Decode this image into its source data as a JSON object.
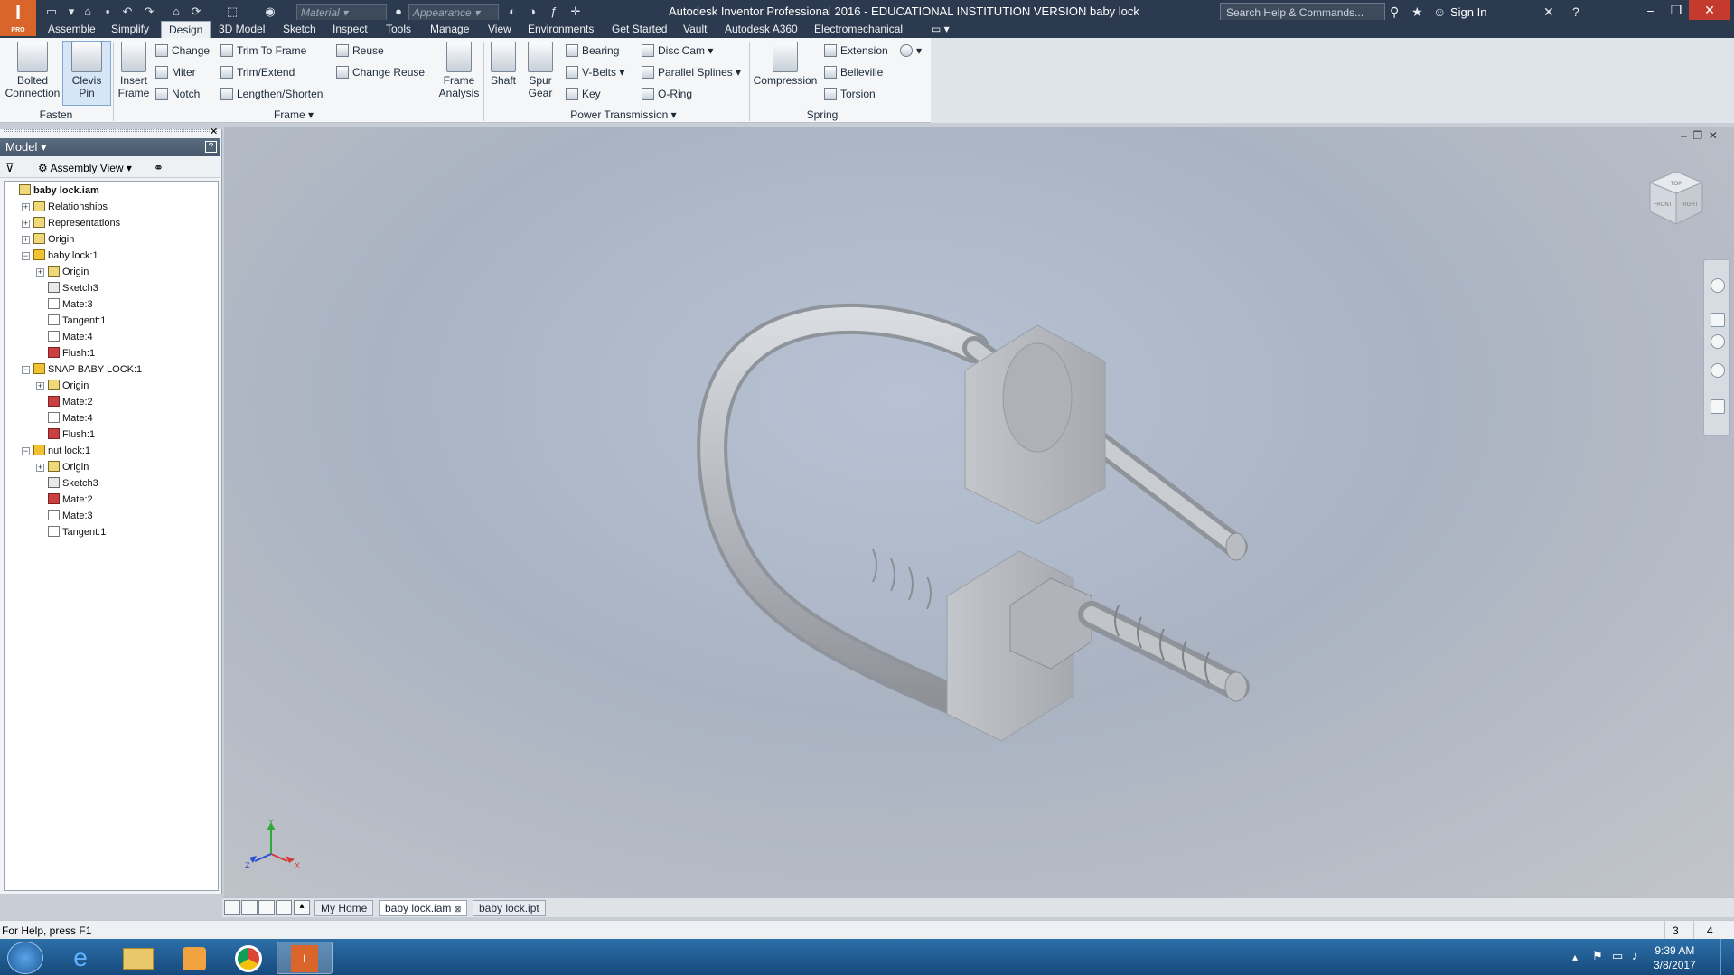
{
  "app": {
    "logo": "I",
    "logo_sub": "PRO",
    "title": "Autodesk Inventor Professional 2016 - EDUCATIONAL INSTITUTION VERSION    baby lock",
    "material_placeholder": "Material",
    "appearance_placeholder": "Appearance",
    "search_placeholder": "Search Help & Commands...",
    "sign_in": "Sign In"
  },
  "menu_tabs": [
    "Assemble",
    "Simplify",
    "Design",
    "3D Model",
    "Sketch",
    "Inspect",
    "Tools",
    "Manage",
    "View",
    "Environments",
    "Get Started",
    "Vault",
    "Autodesk A360",
    "Electromechanical"
  ],
  "ribbon": {
    "fasten": {
      "label": "Fasten",
      "bolted": "Bolted\nConnection",
      "bolted1": "Bolted",
      "bolted2": "Connection",
      "clevis1": "Clevis",
      "clevis2": "Pin"
    },
    "frame": {
      "label": "Frame",
      "insert1": "Insert",
      "insert2": "Frame",
      "change": "Change",
      "miter": "Miter",
      "notch": "Notch",
      "trim_to_frame": "Trim To Frame",
      "trim_extend": "Trim/Extend",
      "lengthen": "Lengthen/Shorten",
      "reuse": "Reuse",
      "change_reuse": "Change Reuse",
      "analysis1": "Frame",
      "analysis2": "Analysis"
    },
    "power": {
      "label": "Power Transmission",
      "shaft": "Shaft",
      "spur1": "Spur",
      "spur2": "Gear",
      "bearing": "Bearing",
      "vbelts": "V-Belts",
      "key": "Key",
      "disc_cam": "Disc Cam",
      "parallel_splines": "Parallel Splines",
      "oring": "O-Ring"
    },
    "spring": {
      "label": "Spring",
      "compression": "Compression",
      "extension": "Extension",
      "belleville": "Belleville",
      "torsion": "Torsion"
    }
  },
  "browser": {
    "title": "Model",
    "view": "Assembly View",
    "tree": [
      {
        "label": "baby lock.iam",
        "level": 0,
        "icon": "assembly",
        "bold": true
      },
      {
        "label": "Relationships",
        "level": 1,
        "icon": "folder",
        "expand": "+"
      },
      {
        "label": "Representations",
        "level": 1,
        "icon": "folder",
        "expand": "+"
      },
      {
        "label": "Origin",
        "level": 1,
        "icon": "folder",
        "expand": "+"
      },
      {
        "label": "baby lock:1",
        "level": 1,
        "icon": "part",
        "expand": "-"
      },
      {
        "label": "Origin",
        "level": 2,
        "icon": "folder",
        "expand": "+"
      },
      {
        "label": "Sketch3",
        "level": 2,
        "icon": "sketch"
      },
      {
        "label": "Mate:3",
        "level": 2,
        "icon": "mate"
      },
      {
        "label": "Tangent:1",
        "level": 2,
        "icon": "mate"
      },
      {
        "label": "Mate:4",
        "level": 2,
        "icon": "mate"
      },
      {
        "label": "Flush:1",
        "level": 2,
        "icon": "flush"
      },
      {
        "label": "SNAP BABY LOCK:1",
        "level": 1,
        "icon": "part",
        "expand": "-"
      },
      {
        "label": "Origin",
        "level": 2,
        "icon": "folder",
        "expand": "+"
      },
      {
        "label": "Mate:2",
        "level": 2,
        "icon": "flush"
      },
      {
        "label": "Mate:4",
        "level": 2,
        "icon": "mate"
      },
      {
        "label": "Flush:1",
        "level": 2,
        "icon": "flush"
      },
      {
        "label": "nut lock:1",
        "level": 1,
        "icon": "part",
        "expand": "-"
      },
      {
        "label": "Origin",
        "level": 2,
        "icon": "folder",
        "expand": "+"
      },
      {
        "label": "Sketch3",
        "level": 2,
        "icon": "sketch"
      },
      {
        "label": "Mate:2",
        "level": 2,
        "icon": "flush"
      },
      {
        "label": "Mate:3",
        "level": 2,
        "icon": "mate"
      },
      {
        "label": "Tangent:1",
        "level": 2,
        "icon": "mate"
      }
    ]
  },
  "viewcube": {
    "top": "TOP",
    "front": "FRONT",
    "right": "RIGHT"
  },
  "axis": {
    "x": "X",
    "y": "Y",
    "z": "Z"
  },
  "doc_tabs": [
    "My Home",
    "baby lock.iam",
    "baby lock.ipt"
  ],
  "status": {
    "help": "For Help, press F1",
    "count_a": "3",
    "count_b": "4"
  },
  "clock": {
    "time": "9:39 AM",
    "date": "3/8/2017"
  }
}
